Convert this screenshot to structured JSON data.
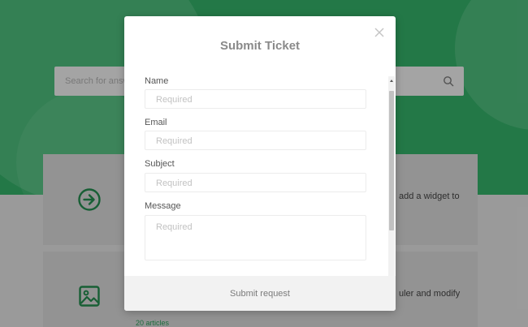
{
  "background": {
    "search": {
      "placeholder": "Search for answers..."
    },
    "cards": [
      {
        "icon": "arrow-right-circle-icon",
        "snippet": "add a widget to"
      },
      {
        "icon": "image-icon",
        "snippet": "uler and modify",
        "articles": "20 articles"
      }
    ],
    "colors": {
      "brand": "#2e9a5c",
      "icon": "#1f7a45"
    }
  },
  "modal": {
    "title": "Submit Ticket",
    "close_icon": "close-icon",
    "fields": [
      {
        "label": "Name",
        "placeholder": "Required",
        "value": ""
      },
      {
        "label": "Email",
        "placeholder": "Required",
        "value": ""
      },
      {
        "label": "Subject",
        "placeholder": "Required",
        "value": ""
      },
      {
        "label": "Message",
        "placeholder": "Required",
        "value": ""
      }
    ],
    "submit_label": "Submit request"
  }
}
